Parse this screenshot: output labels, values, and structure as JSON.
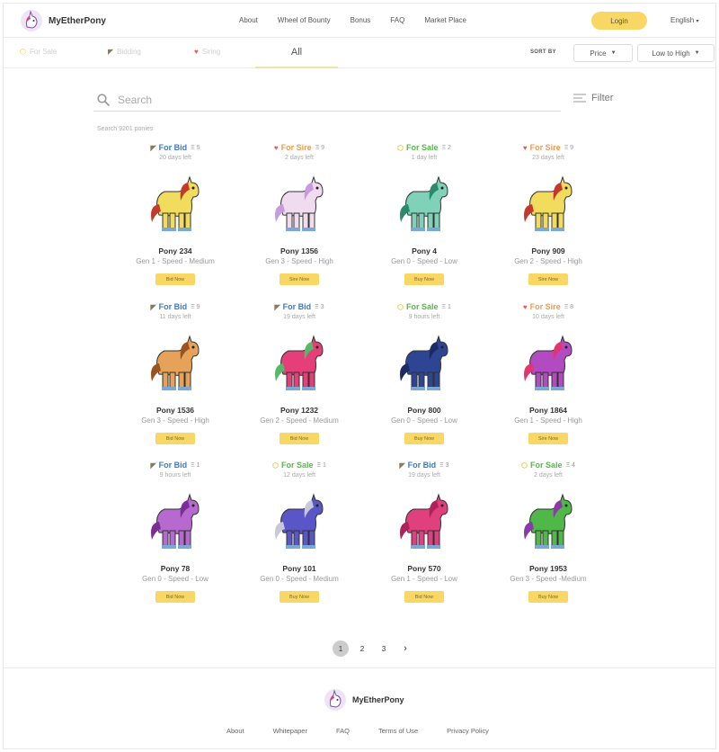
{
  "brand": {
    "name": "MyEtherPony"
  },
  "nav": [
    "About",
    "Wheel of Bounty",
    "Bonus",
    "FAQ",
    "Market Place"
  ],
  "login_label": "Login",
  "language": "English",
  "tabs": {
    "for_sale": "For Sale",
    "bidding": "Bidding",
    "siring": "Siring",
    "all": "All"
  },
  "sort": {
    "label": "SORT BY",
    "field": "Price",
    "order": "Low to High"
  },
  "search": {
    "placeholder": "Search",
    "filter_label": "Filter",
    "count_text": "Search 9201 ponies"
  },
  "colors": {
    "accent": "#f8d765",
    "for_bid": "#3a7ac8",
    "for_sire": "#f09a50",
    "for_sale": "#56b84a"
  },
  "ponies": [
    {
      "status": "For Bid",
      "eth": "Ξ 5",
      "time": "20 days left",
      "name": "Pony 234",
      "desc": "Gen 1 - Speed - Medium",
      "action": "Bid Now",
      "body": "#f2dc5d",
      "mane": "#c4392c"
    },
    {
      "status": "For Sire",
      "eth": "Ξ 9",
      "time": "2 days left",
      "name": "Pony 1356",
      "desc": "Gen 3 - Speed - High",
      "action": "Sire Now",
      "body": "#f1dcef",
      "mane": "#c69be0"
    },
    {
      "status": "For Sale",
      "eth": "Ξ 2",
      "time": "1 day left",
      "name": "Pony 4",
      "desc": "Gen 0 - Speed - Low",
      "action": "Buy Now",
      "body": "#7fd2b8",
      "mane": "#2b8a6c"
    },
    {
      "status": "For Sire",
      "eth": "Ξ 9",
      "time": "23 days left",
      "name": "Pony 909",
      "desc": "Gen 2 - Speed - High",
      "action": "Sire Now",
      "body": "#f2dc5d",
      "mane": "#c4392c"
    },
    {
      "status": "For Bid",
      "eth": "Ξ 9",
      "time": "11 days left",
      "name": "Pony 1536",
      "desc": "Gen 3 - Speed - High",
      "action": "Bid Now",
      "body": "#e7a25a",
      "mane": "#9a5221"
    },
    {
      "status": "For Bid",
      "eth": "Ξ 3",
      "time": "19 days left",
      "name": "Pony 1232",
      "desc": "Gen 2 - Speed - Medium",
      "action": "Bid Now",
      "body": "#e53f7a",
      "mane": "#56b86a"
    },
    {
      "status": "For Sale",
      "eth": "Ξ 1",
      "time": "9 hours left",
      "name": "Pony 800",
      "desc": "Gen 0 - Speed - Low",
      "action": "Buy Now",
      "body": "#2e4594",
      "mane": "#1c2b66"
    },
    {
      "status": "For Sire",
      "eth": "Ξ 8",
      "time": "10 days left",
      "name": "Pony 1864",
      "desc": "Gen 1 - Speed - High",
      "action": "Sire Now",
      "body": "#b24ac1",
      "mane": "#e5336e"
    },
    {
      "status": "For Bid",
      "eth": "Ξ 1",
      "time": "9 hours left",
      "name": "Pony 78",
      "desc": "Gen 0 - Speed - Low",
      "action": "Bid Now",
      "body": "#b66ad0",
      "mane": "#7a2e9a"
    },
    {
      "status": "For Sale",
      "eth": "Ξ 1",
      "time": "12 days left",
      "name": "Pony 101",
      "desc": "Gen 0 - Speed - Medium",
      "action": "Buy Now",
      "body": "#5a56c8",
      "mane": "#c8c8d8"
    },
    {
      "status": "For Bid",
      "eth": "Ξ 3",
      "time": "19 days left",
      "name": "Pony 570",
      "desc": "Gen 1 - Speed - Low",
      "action": "Bid Now",
      "body": "#e0407e",
      "mane": "#b0205a"
    },
    {
      "status": "For Sale",
      "eth": "Ξ 4",
      "time": "2 days left",
      "name": "Pony 1953",
      "desc": "Gen 3  - Speed -Medium",
      "action": "Buy Now",
      "body": "#4fb848",
      "mane": "#8a3aa8"
    }
  ],
  "pagination": {
    "pages": [
      "1",
      "2",
      "3"
    ],
    "next": "›"
  },
  "footer": {
    "brand": "MyEtherPony",
    "links": [
      "About",
      "Whitepaper",
      "FAQ",
      "Terms of Use",
      "Privacy Policy"
    ]
  }
}
